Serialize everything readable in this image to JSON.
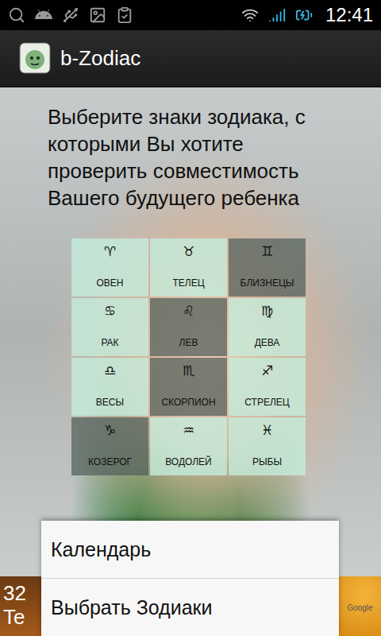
{
  "status_bar": {
    "time": "12:41"
  },
  "app_bar": {
    "title": "b-Zodiac"
  },
  "prompt": "Выберите знаки зодиака, с которыми Вы хотите проверить совместимость Вашего будущего ребенка",
  "signs": [
    {
      "symbol": "♈",
      "label": "ОВЕН",
      "selected": false
    },
    {
      "symbol": "♉",
      "label": "ТЕЛЕЦ",
      "selected": false
    },
    {
      "symbol": "♊",
      "label": "БЛИЗНЕЦЫ",
      "selected": true
    },
    {
      "symbol": "♋",
      "label": "РАК",
      "selected": false
    },
    {
      "symbol": "♌",
      "label": "ЛЕВ",
      "selected": true
    },
    {
      "symbol": "♍",
      "label": "ДЕВА",
      "selected": false
    },
    {
      "symbol": "♎",
      "label": "ВЕСЫ",
      "selected": false
    },
    {
      "symbol": "♏",
      "label": "СКОРПИОН",
      "selected": true
    },
    {
      "symbol": "♐",
      "label": "СТРЕЛЕЦ",
      "selected": false
    },
    {
      "symbol": "♑",
      "label": "КОЗЕРОГ",
      "selected": true
    },
    {
      "symbol": "♒",
      "label": "ВОДОЛЕЙ",
      "selected": false
    },
    {
      "symbol": "♓",
      "label": "РЫБЫ",
      "selected": false
    }
  ],
  "menu": {
    "items": [
      "Календарь",
      "Выбрать Зодиаки"
    ]
  },
  "ad": {
    "left_text": [
      "32",
      "Te"
    ],
    "right_text": "Google"
  }
}
